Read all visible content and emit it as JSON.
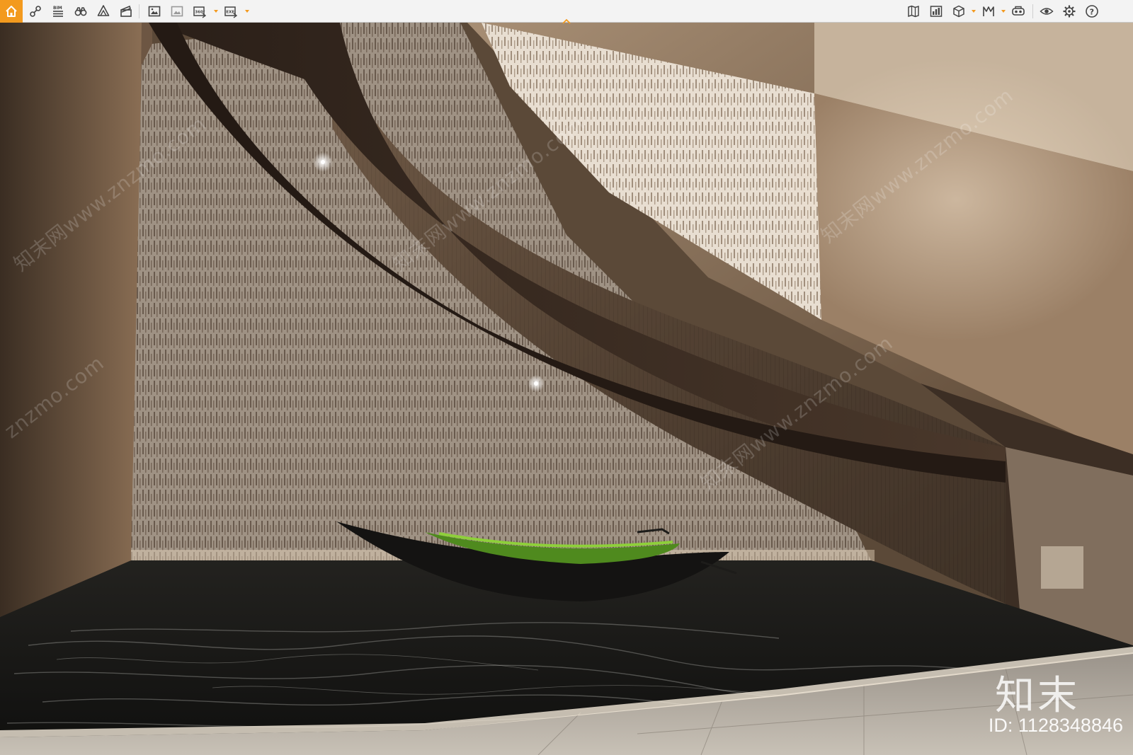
{
  "toolbar": {
    "left_tools": [
      {
        "name": "home-icon"
      },
      {
        "name": "measure-icon"
      },
      {
        "name": "bim-icon",
        "label": "BIM"
      },
      {
        "name": "binoculars-icon"
      },
      {
        "name": "mountain-icon"
      },
      {
        "name": "clapper-icon"
      },
      {
        "name": "screenshot-icon"
      },
      {
        "name": "render-icon"
      },
      {
        "name": "export-360-icon",
        "label": "360°"
      },
      {
        "name": "export-exe-icon",
        "label": "EXE"
      }
    ],
    "right_tools": [
      {
        "name": "map-icon"
      },
      {
        "name": "chart-icon"
      },
      {
        "name": "cube-icon"
      },
      {
        "name": "path-icon"
      },
      {
        "name": "vr-icon"
      },
      {
        "name": "eye-icon"
      },
      {
        "name": "gear-icon"
      },
      {
        "name": "help-icon",
        "label": "?"
      }
    ],
    "accent_color": "#f39a1e"
  },
  "watermark": {
    "logo_text": "知末",
    "id_text": "ID: 1128348846",
    "diagonal_text": "知末网www.znzmo.com",
    "site_text": "znzmo.com"
  }
}
